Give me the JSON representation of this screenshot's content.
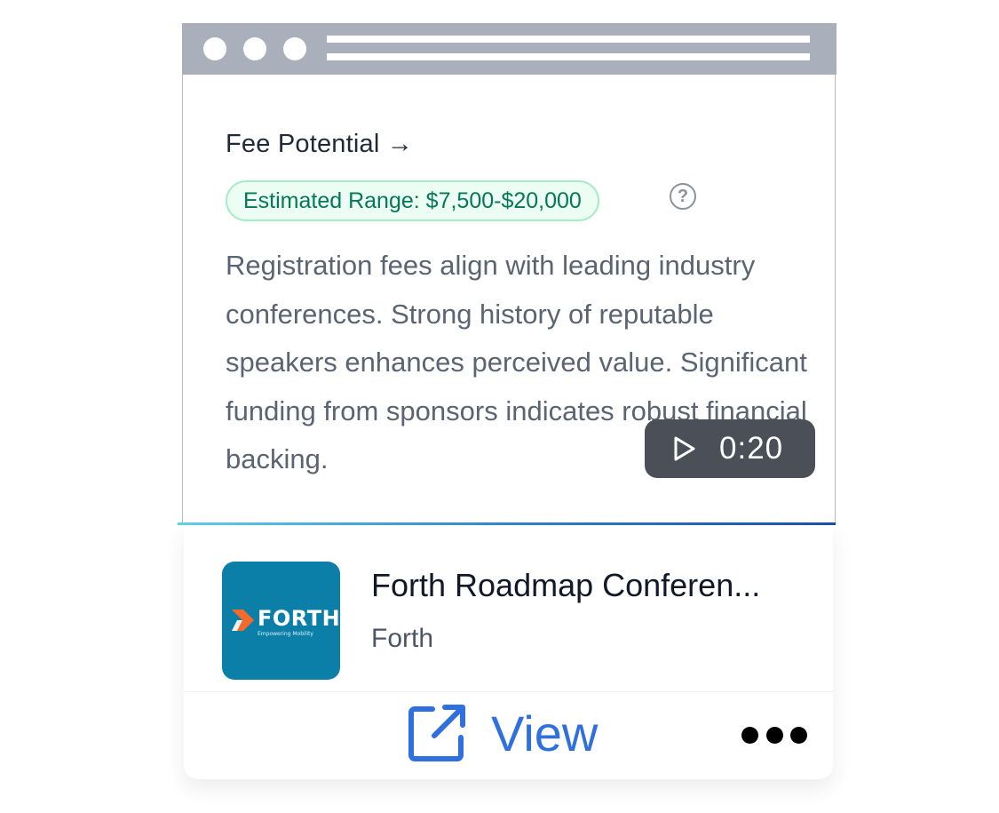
{
  "fee": {
    "title": "Fee Potential →",
    "range_badge": "Estimated Range: $7,500-$20,000",
    "help_icon": "question-circle-icon",
    "description": "Registration fees align with leading industry conferences. Strong history of reputable speakers enhances perceived value. Significant funding from sponsors indicates robust financial backing."
  },
  "video": {
    "icon": "play-icon",
    "time": "0:20"
  },
  "event": {
    "logo_text": "FORTH",
    "logo_tagline": "Empowering Mobility",
    "title": "Forth Roadmap Conferen...",
    "organization": "Forth"
  },
  "actions": {
    "view_label": "View",
    "view_icon": "external-link-icon",
    "more_icon": "more-horizontal-icon"
  },
  "colors": {
    "badge_text": "#047857",
    "badge_bg": "#ecfdf3",
    "link": "#2f6fde",
    "logo_bg": "#0b7fa8"
  }
}
